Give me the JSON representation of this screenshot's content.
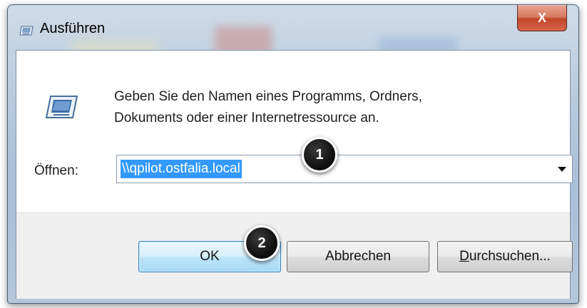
{
  "window": {
    "title": "Ausführen",
    "close_glyph": "X"
  },
  "dialog": {
    "description_line1": "Geben Sie den Namen eines Programms, Ordners,",
    "description_line2": "Dokuments oder einer Internetressource an.",
    "open_label": "Öffnen:",
    "open_value": "\\\\qpilot.ostfalia.local"
  },
  "buttons": {
    "ok": "OK",
    "cancel": "Abbrechen",
    "browse_mnemonic": "D",
    "browse_rest": "urchsuchen..."
  },
  "annotations": {
    "marker1": "1",
    "marker2": "2"
  },
  "icons": [
    "run-icon",
    "close-icon",
    "dropdown-arrow-icon"
  ],
  "colors": {
    "selection": "#3399ff",
    "close": "#c2462a",
    "ok_border": "#3c7fb1"
  }
}
